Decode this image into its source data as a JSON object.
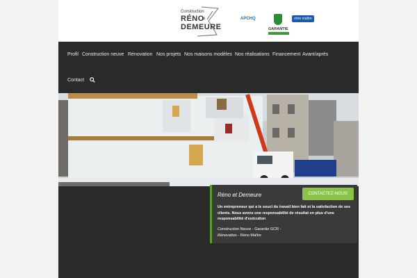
{
  "header": {
    "logo": {
      "small": "Construction",
      "line1": "RÉNO",
      "amp": "&",
      "line2": "DEMEURE"
    },
    "partners": {
      "apchq": "APCHQ",
      "garantie": "GARANTIE",
      "renomaitre": "réno maître"
    }
  },
  "nav": {
    "items": [
      "Profil",
      "Construction neuve",
      "Rénovation",
      "Nos projets",
      "Nos maisons modèles",
      "Nos réalisations",
      "Financement",
      "Avant/après",
      "Contact"
    ],
    "search_icon": "search-icon"
  },
  "info": {
    "title": "Réno et Demeure",
    "button": "CONTACTEZ-NOUS!",
    "description": "Un entrepreneur qui a le souci du travail bien fait et la satisfaction de ses clients. Nous avons une responsabilité de résultat en plus d'une responsabilité d'exécution",
    "link1a": "Construction Neuve",
    "sep1": " - ",
    "link1b": "Garantie GCR",
    "sep2": " -",
    "link2a": "Rénovation",
    "sep3": " - ",
    "link2b": "Réno Maître"
  },
  "colors": {
    "nav_bg": "#2a2a2a",
    "accent": "#8bc34a",
    "panel": "#3a3a3a"
  }
}
